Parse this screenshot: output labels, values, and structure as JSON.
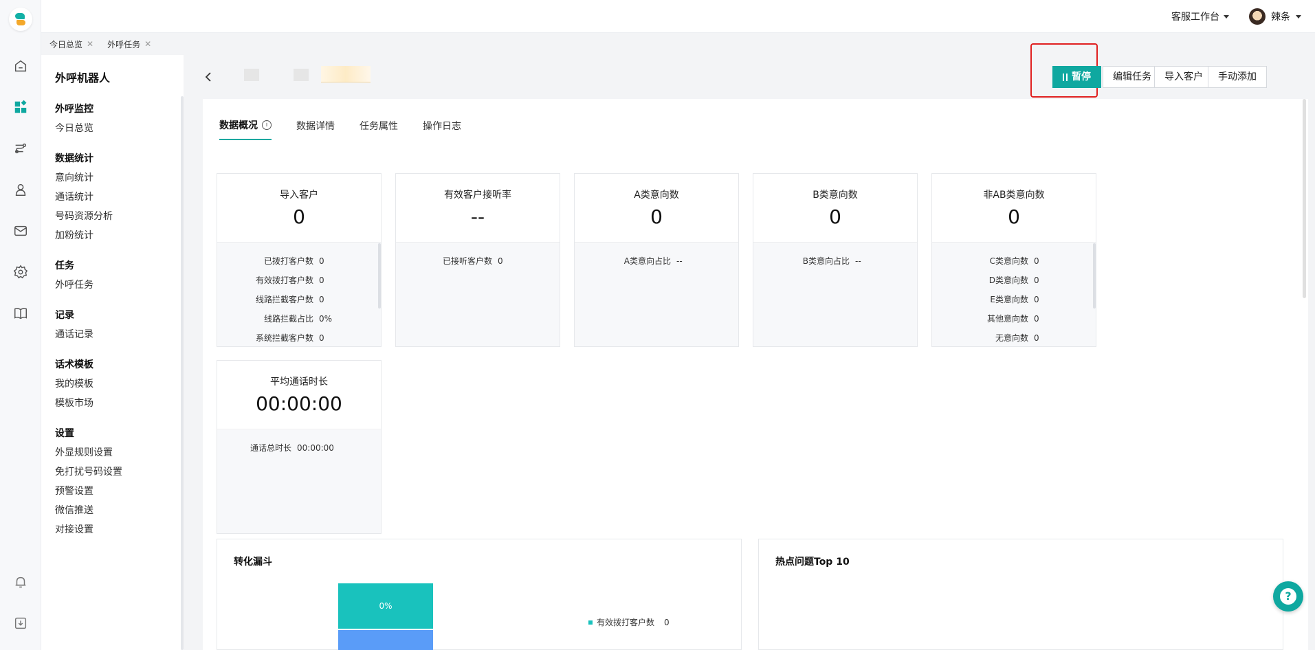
{
  "topbar": {
    "workspace": "客服工作台",
    "user": "辣条"
  },
  "open_tabs": [
    {
      "label": "今日总览"
    },
    {
      "label": "外呼任务"
    }
  ],
  "subnav": {
    "title": "外呼机器人",
    "groups": [
      {
        "title": "外呼监控",
        "items": [
          "今日总览"
        ]
      },
      {
        "title": "数据统计",
        "items": [
          "意向统计",
          "通话统计",
          "号码资源分析",
          "加粉统计"
        ]
      },
      {
        "title": "任务",
        "items": [
          "外呼任务"
        ]
      },
      {
        "title": "记录",
        "items": [
          "通话记录"
        ]
      },
      {
        "title": "话术模板",
        "items": [
          "我的模板",
          "模板市场"
        ]
      },
      {
        "title": "设置",
        "items": [
          "外显规则设置",
          "免打扰号码设置",
          "预警设置",
          "微信推送",
          "对接设置"
        ]
      }
    ]
  },
  "actions": {
    "pause": "暂停",
    "edit": "编辑任务",
    "import": "导入客户",
    "add": "手动添加"
  },
  "tabs": [
    {
      "label": "数据概况"
    },
    {
      "label": "数据详情"
    },
    {
      "label": "任务属性"
    },
    {
      "label": "操作日志"
    }
  ],
  "cards": [
    {
      "label": "导入客户",
      "value": "0",
      "rows": [
        {
          "k": "已拨打客户数",
          "v": "0"
        },
        {
          "k": "有效拨打客户数",
          "v": "0"
        },
        {
          "k": "线路拦截客户数",
          "v": "0"
        },
        {
          "k": "线路拦截占比",
          "v": "0%"
        },
        {
          "k": "系统拦截客户数",
          "v": "0"
        }
      ]
    },
    {
      "label": "有效客户接听率",
      "value": "--",
      "rows": [
        {
          "k": "已接听客户数",
          "v": "0"
        }
      ]
    },
    {
      "label": "A类意向数",
      "value": "0",
      "rows": [
        {
          "k": "A类意向占比",
          "v": "--"
        }
      ]
    },
    {
      "label": "B类意向数",
      "value": "0",
      "rows": [
        {
          "k": "B类意向占比",
          "v": "--"
        }
      ]
    },
    {
      "label": "非AB类意向数",
      "value": "0",
      "rows": [
        {
          "k": "C类意向数",
          "v": "0"
        },
        {
          "k": "D类意向数",
          "v": "0"
        },
        {
          "k": "E类意向数",
          "v": "0"
        },
        {
          "k": "其他意向数",
          "v": "0"
        },
        {
          "k": "无意向数",
          "v": "0"
        }
      ]
    },
    {
      "label": "平均通话时长",
      "value": "00:00:00",
      "rows": [
        {
          "k": "通话总时长",
          "v": "00:00:00"
        }
      ]
    }
  ],
  "funnel": {
    "title": "转化漏斗",
    "segment_label": "0%",
    "legend": {
      "label": "有效拨打客户数",
      "value": "0"
    }
  },
  "hot": {
    "title": "热点问题Top 10"
  },
  "colors": {
    "accent": "#0fa8a0",
    "highlight": "#e02020",
    "funnel_primary": "#19c2bd",
    "funnel_secondary": "#5a9cf8"
  }
}
